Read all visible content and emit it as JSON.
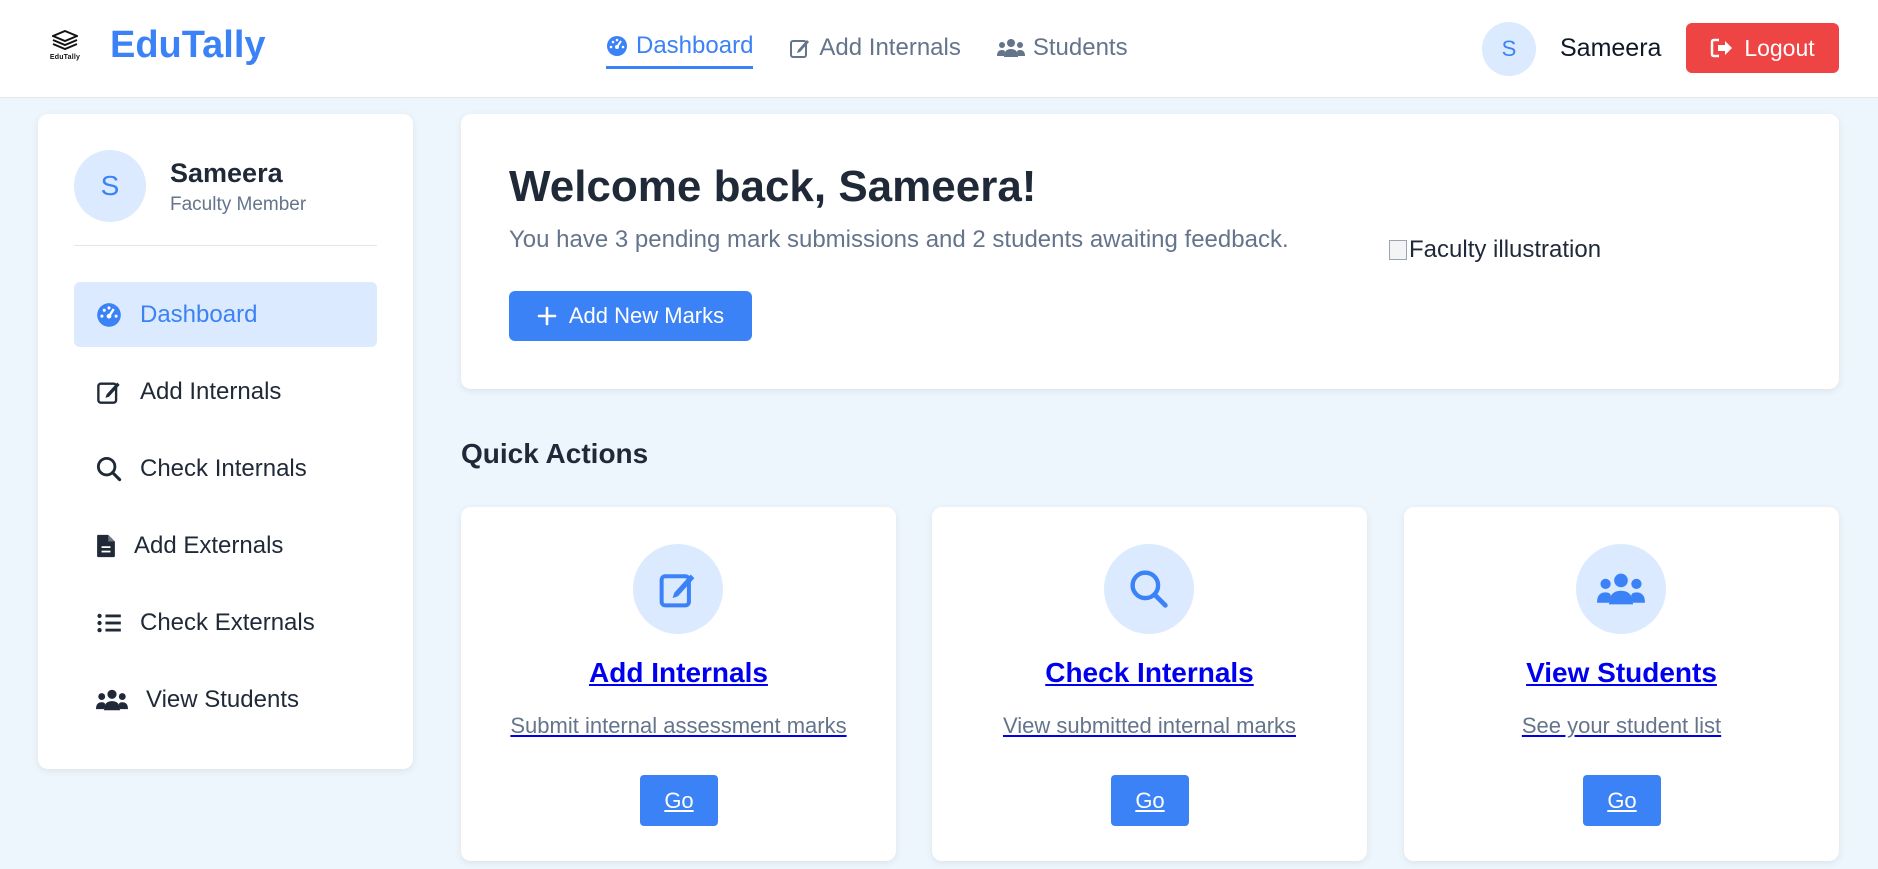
{
  "colors": {
    "accent": "#3b82f6",
    "danger": "#ef4444",
    "accent_soft": "#dbeafe"
  },
  "brand": {
    "logo_text": "EduTally",
    "name": "EduTally"
  },
  "topnav": {
    "items": [
      {
        "label": "Dashboard",
        "icon": "gauge-icon",
        "active": true
      },
      {
        "label": "Add Internals",
        "icon": "edit-icon",
        "active": false
      },
      {
        "label": "Students",
        "icon": "users-icon",
        "active": false
      }
    ]
  },
  "user": {
    "initial": "S",
    "name": "Sameera",
    "role": "Faculty Member"
  },
  "logout_label": "Logout",
  "sidebar": {
    "items": [
      {
        "label": "Dashboard",
        "icon": "gauge-icon",
        "active": true
      },
      {
        "label": "Add Internals",
        "icon": "edit-icon",
        "active": false
      },
      {
        "label": "Check Internals",
        "icon": "search-icon",
        "active": false
      },
      {
        "label": "Add Externals",
        "icon": "file-icon",
        "active": false
      },
      {
        "label": "Check Externals",
        "icon": "list-icon",
        "active": false
      },
      {
        "label": "View Students",
        "icon": "users-icon",
        "active": false
      }
    ]
  },
  "welcome": {
    "title": "Welcome back, Sameera!",
    "subtitle": "You have 3 pending mark submissions and 2 students awaiting feedback.",
    "button_label": "Add New Marks",
    "image_alt": "Faculty illustration"
  },
  "quick_actions": {
    "title": "Quick Actions",
    "cards": [
      {
        "icon": "edit-icon",
        "title": "Add Internals",
        "description": "Submit internal assessment marks",
        "button_label": "Go"
      },
      {
        "icon": "search-icon",
        "title": "Check Internals",
        "description": "View submitted internal marks",
        "button_label": "Go"
      },
      {
        "icon": "users-icon",
        "title": "View Students",
        "description": "See your student list",
        "button_label": "Go"
      }
    ]
  }
}
